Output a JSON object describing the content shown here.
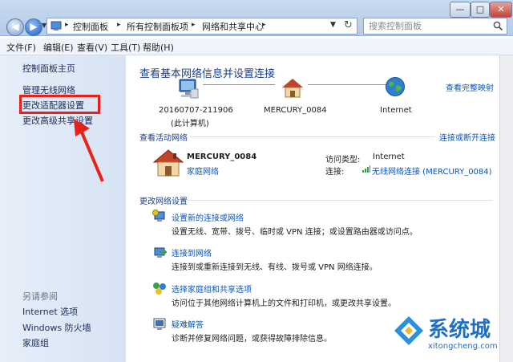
{
  "address": {
    "segments": [
      "控制面板",
      "所有控制面板项",
      "网络和共享中心"
    ]
  },
  "search": {
    "placeholder": "搜索控制面板"
  },
  "menu": [
    "文件(F)",
    "编辑(E)",
    "查看(V)",
    "工具(T)",
    "帮助(H)"
  ],
  "sidebar": {
    "items": [
      "控制面板主页",
      "管理无线网络",
      "更改适配器设置",
      "更改高级共享设置"
    ],
    "see_also_title": "另请参阅",
    "see_also": [
      "Internet 选项",
      "Windows 防火墙",
      "家庭组"
    ]
  },
  "main": {
    "heading": "查看基本网络信息并设置连接",
    "full_map": "查看完整映射",
    "map": {
      "computer_name": "20160707-211906",
      "computer_sub": "(此计算机)",
      "network_name": "MERCURY_0084",
      "internet": "Internet"
    },
    "active_title": "查看活动网络",
    "connect_disconnect": "连接或断开连接",
    "network": {
      "name": "MERCURY_0084",
      "type": "家庭网络",
      "access_label": "访问类型:",
      "access_value": "Internet",
      "connection_label": "连接:",
      "connection_value": "无线网络连接 (MERCURY_0084)"
    },
    "change_title": "更改网络设置",
    "tasks": [
      {
        "title": "设置新的连接或网络",
        "desc": "设置无线、宽带、拨号、临时或 VPN 连接；或设置路由器或访问点。"
      },
      {
        "title": "连接到网络",
        "desc": "连接到或重新连接到无线、有线、拨号或 VPN 网络连接。"
      },
      {
        "title": "选择家庭组和共享选项",
        "desc": "访问位于其他网络计算机上的文件和打印机，或更改共享设置。"
      },
      {
        "title": "疑难解答",
        "desc": "诊断并修复网络问题，或获得故障排除信息。"
      }
    ]
  },
  "watermark": {
    "text": "系统城",
    "url": "xitongcheng.com"
  },
  "annotation_color": "#e8211b",
  "window_buttons": [
    "—",
    "□",
    "✕"
  ]
}
